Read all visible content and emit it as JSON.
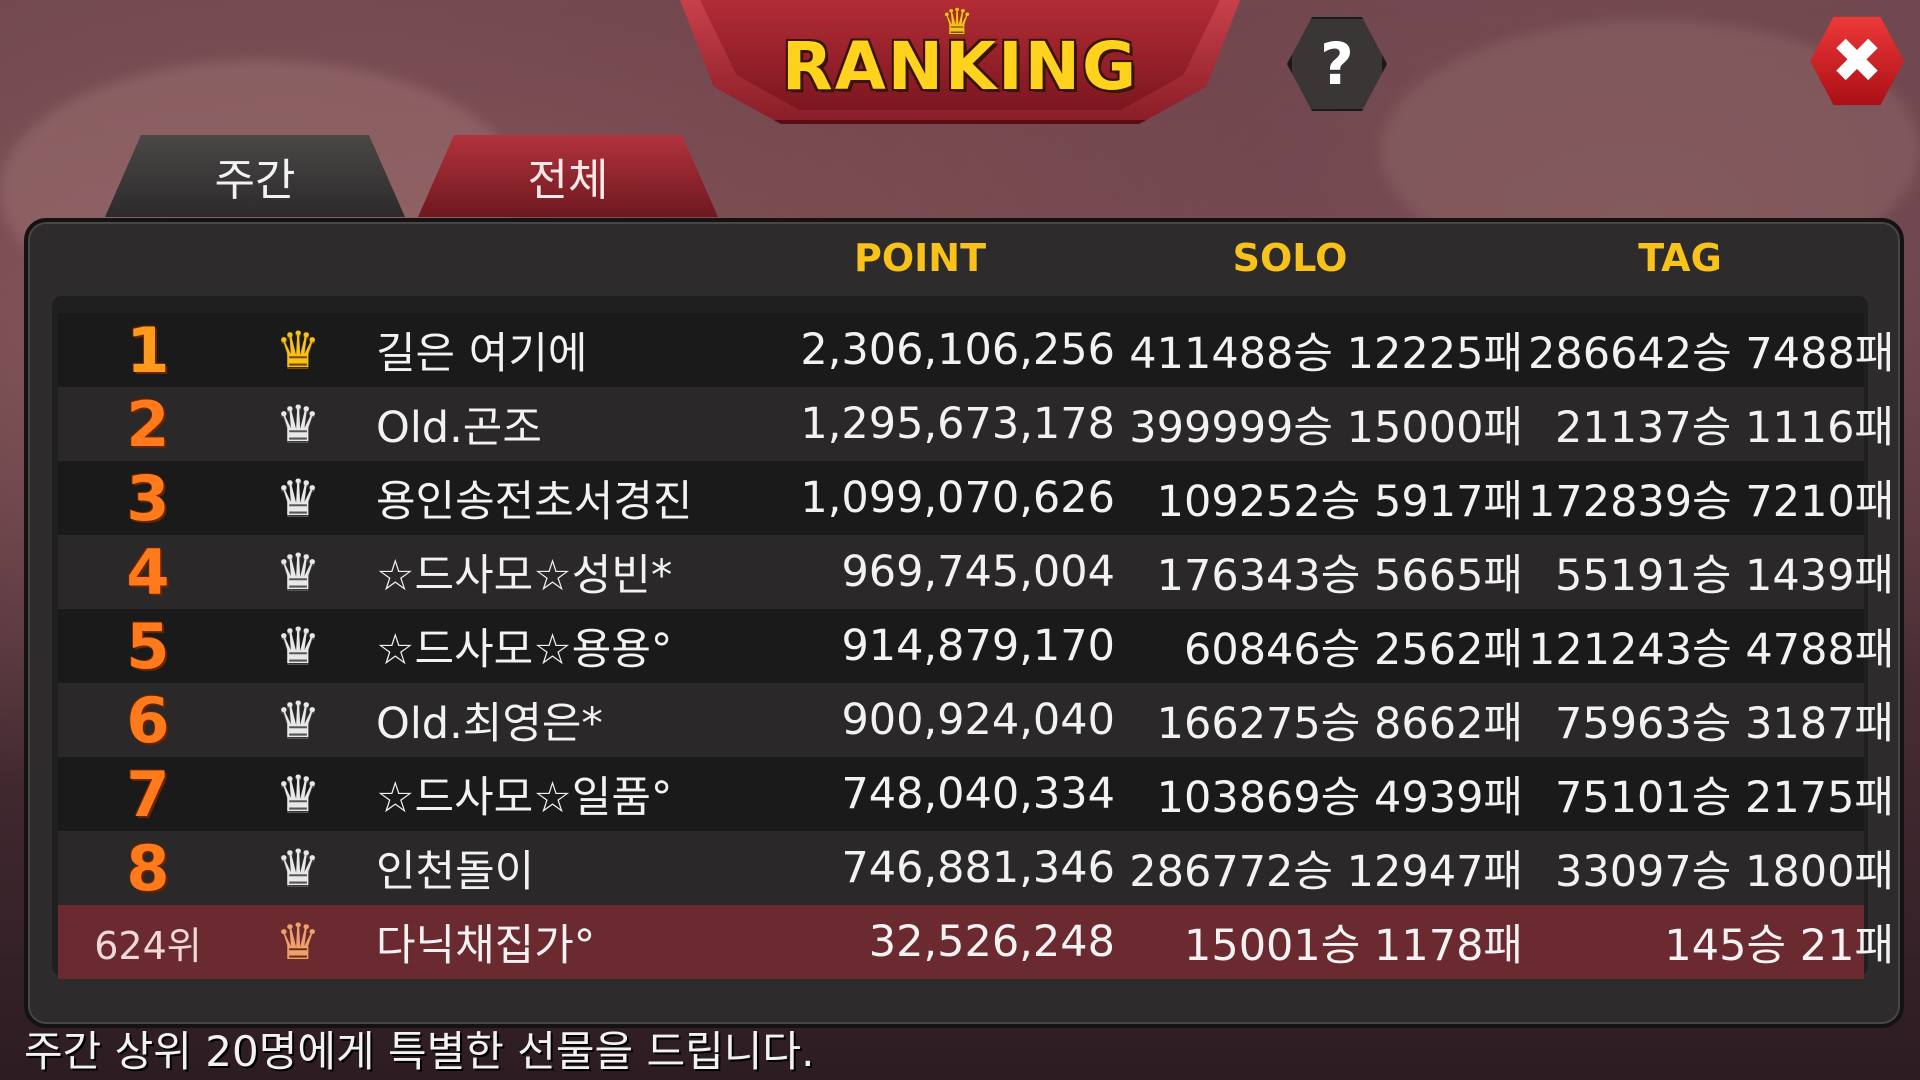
{
  "header": {
    "title": "RANKING",
    "help_label": "?",
    "close_label": "✖"
  },
  "tabs": [
    {
      "label": "주간"
    },
    {
      "label": "전체"
    }
  ],
  "columns": {
    "point": "POINT",
    "solo": "SOLO",
    "tag": "TAG"
  },
  "rows": [
    {
      "rank": "1",
      "name": "길은 여기에",
      "point": "2,306,106,256",
      "solo": "411488승 12225패",
      "tag": "286642승 7488패"
    },
    {
      "rank": "2",
      "name": "Old.곤조",
      "point": "1,295,673,178",
      "solo": "399999승 15000패",
      "tag": "21137승 1116패"
    },
    {
      "rank": "3",
      "name": "용인송전초서경진",
      "point": "1,099,070,626",
      "solo": "109252승 5917패",
      "tag": "172839승 7210패"
    },
    {
      "rank": "4",
      "name": "☆드사모☆성빈*",
      "point": "969,745,004",
      "solo": "176343승 5665패",
      "tag": "55191승 1439패"
    },
    {
      "rank": "5",
      "name": "☆드사모☆용용°",
      "point": "914,879,170",
      "solo": "60846승 2562패",
      "tag": "121243승 4788패"
    },
    {
      "rank": "6",
      "name": "Old.최영은*",
      "point": "900,924,040",
      "solo": "166275승 8662패",
      "tag": "75963승 3187패"
    },
    {
      "rank": "7",
      "name": "☆드사모☆일품°",
      "point": "748,040,334",
      "solo": "103869승 4939패",
      "tag": "75101승 2175패"
    },
    {
      "rank": "8",
      "name": "인천돌이",
      "point": "746,881,346",
      "solo": "286772승 12947패",
      "tag": "33097승 1800패"
    }
  ],
  "my_row": {
    "rank": "624위",
    "name": "다닉채집가°",
    "point": "32,526,248",
    "solo": "15001승 1178패",
    "tag": "145승 21패"
  },
  "footer": "주간 상위 20명에게 특별한 선물을 드립니다.",
  "icons": {
    "crown": "crown-icon",
    "help": "help-icon",
    "close": "close-icon"
  },
  "colors": {
    "accent_gold": "#f8c21a",
    "rank_orange": "#ff7a1a",
    "banner_red": "#b32c36",
    "my_row_bg": "#6a2a30"
  }
}
